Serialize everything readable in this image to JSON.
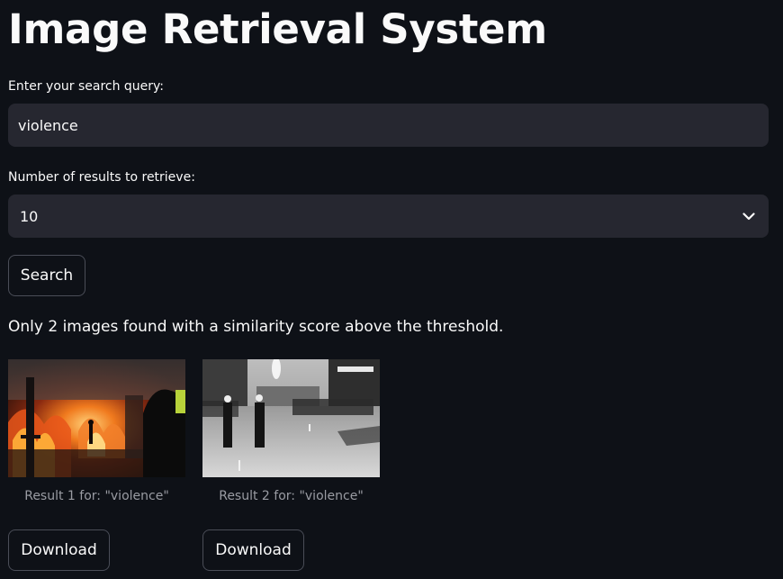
{
  "page": {
    "title": "Image Retrieval System"
  },
  "query": {
    "label": "Enter your search query:",
    "value": "violence"
  },
  "num_results": {
    "label": "Number of results to retrieve:",
    "selected": "10"
  },
  "search_button": {
    "label": "Search"
  },
  "status": {
    "message": "Only 2 images found with a similarity score above the threshold."
  },
  "results": [
    {
      "caption": "Result 1 for: \"violence\"",
      "download_label": "Download"
    },
    {
      "caption": "Result 2 for: \"violence\"",
      "download_label": "Download"
    }
  ],
  "icons": {
    "select_chevron": "chevron-down-icon"
  },
  "colors": {
    "background": "#0e1117",
    "input_background": "#262730",
    "text": "#fafafa",
    "caption_text": "#9a9ca3",
    "button_border": "#4a4d57"
  }
}
